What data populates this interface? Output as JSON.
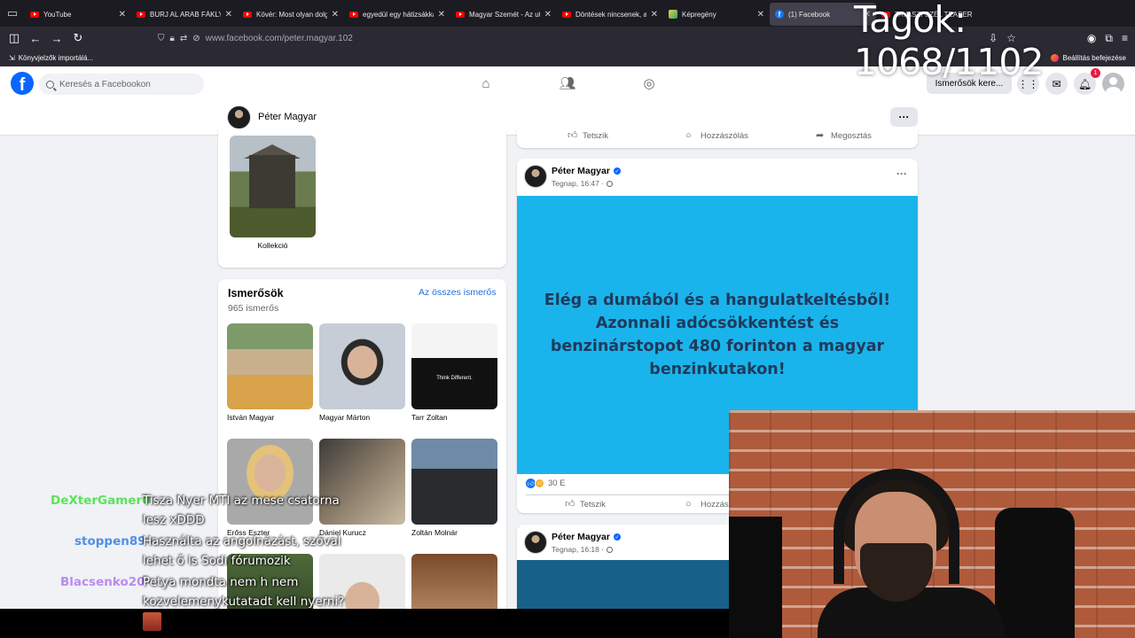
{
  "browser": {
    "tabs": [
      {
        "label": "YouTube",
        "favicon": "youtube-icon",
        "active": false
      },
      {
        "label": "BURJ AL ARAB FÁKLYA",
        "favicon": "youtube-icon",
        "active": false
      },
      {
        "label": "Kövér: Most olyan dolg",
        "favicon": "youtube-icon",
        "active": false
      },
      {
        "label": "egyedül egy hátizsákka",
        "favicon": "youtube-icon",
        "active": false
      },
      {
        "label": "Magyar Szemét - Az ut",
        "favicon": "youtube-icon",
        "active": false
      },
      {
        "label": "Döntések nincsenek, a",
        "favicon": "youtube-icon",
        "active": false
      },
      {
        "label": "Képregény",
        "favicon": "image-icon",
        "active": false
      },
      {
        "label": "(1) Facebook",
        "favicon": "facebook-icon",
        "active": true
      },
      {
        "label": "TAVASZI SZÉL TEASER",
        "favicon": "youtube-icon",
        "active": false
      }
    ],
    "url": "www.facebook.com/peter.magyar.102",
    "bookmarks": {
      "import_label": "Könyvjelzők importálá...",
      "setup_label": "Beállítás befejezése"
    }
  },
  "facebook": {
    "search_placeholder": "Keresés a Facebookon",
    "find_friends_label": "Ismerősök kere...",
    "notification_count": "1",
    "profile_name": "Péter Magyar",
    "collection_label": "Kollekció",
    "friends": {
      "title": "Ismerősök",
      "count": "965 ismerős",
      "see_all": "Az összes ismerős",
      "items": [
        {
          "name": "István Magyar"
        },
        {
          "name": "Magyar Márton"
        },
        {
          "name": "Tarr Zoltan"
        },
        {
          "name": "Erőss Eszter"
        },
        {
          "name": "Dániel Kurucz"
        },
        {
          "name": "Zoltán Molnár"
        },
        {
          "name": ""
        },
        {
          "name": ""
        },
        {
          "name": ""
        }
      ],
      "tshirt_text": "Think Different."
    },
    "actions": {
      "like": "Tetszik",
      "comment": "Hozzászólás",
      "comment_truncated": "Hozzász",
      "share": "Megosztás"
    },
    "posts": [
      {
        "author": "Péter Magyar",
        "time": "Tegnap, 16:47 ·",
        "banner_text": "Elég a dumából és a hangulatkeltésből! Azonnali adócsökkentést és benzinárstopot 480 forinton a magyar benzinkutakon!",
        "reactions": "30 E"
      },
      {
        "author": "Péter Magyar",
        "time": "Tegnap, 16:18 ·"
      }
    ]
  },
  "overlay": {
    "counter": "Tagok: 1068/1102",
    "chat": [
      {
        "user": "DeXterGamer0",
        "user_color": "#5be35b",
        "message": "Tisza Nyer MTI az mese csatorna"
      },
      {
        "user": "",
        "user_color": "",
        "message": "lesz xDDD"
      },
      {
        "user": "stoppen89",
        "user_color": "#4f8fe8",
        "message": "Használta az angolnázást, szóval"
      },
      {
        "user": "",
        "user_color": "",
        "message": "lehet ő is Sodi fórumozik"
      },
      {
        "user": "Blacsenko20",
        "user_color": "#b98cf0",
        "message": "Petya mondta nem h nem"
      },
      {
        "user": "",
        "user_color": "",
        "message": "kozvelemenykutatadt kell nyerni?"
      }
    ]
  },
  "colors": {
    "fb_blue": "#0866ff",
    "banner_bg": "#1ab4ec",
    "banner_text": "#1f3a5c"
  }
}
